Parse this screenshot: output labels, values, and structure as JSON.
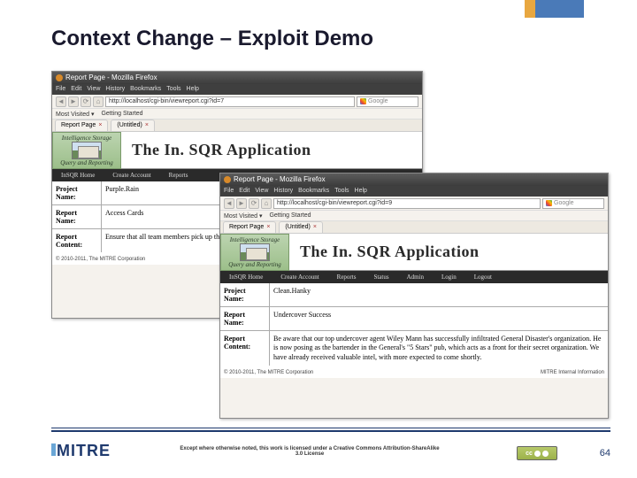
{
  "slide": {
    "title": "Context Change – Exploit Demo",
    "page_number": "64",
    "license_text": "Except where otherwise noted, this work is licensed under a Creative Commons Attribution-ShareAlike 3.0 License",
    "logo": "MITRE",
    "cc_label": "cc"
  },
  "browser_a": {
    "title": "Report Page - Mozilla Firefox",
    "menu": [
      "File",
      "Edit",
      "View",
      "History",
      "Bookmarks",
      "Tools",
      "Help"
    ],
    "url": "http://localhost/cgi-bin/viewreport.cgi?id=7",
    "search_placeholder": "Google",
    "bookmarks": [
      "Most Visited ▾",
      "Getting Started"
    ],
    "tabs": [
      {
        "label": "Report Page"
      },
      {
        "label": "(Untitled)"
      }
    ],
    "banner": {
      "top": "Intelligence Storage",
      "bottom": "Query and Reporting",
      "app_title": "The In. SQR Application"
    },
    "nav_items": [
      "InSQR Home",
      "Create Account",
      "Reports"
    ],
    "form": [
      {
        "label": "Project Name:",
        "value": "Purple.Rain"
      },
      {
        "label": "Report Name:",
        "value": "Access Cards"
      },
      {
        "label": "Report Content:",
        "value": "Ensure that all team members pick up their new Access Cards and destroy your old cards once…"
      }
    ],
    "copyright": "© 2010-2011, The MITRE Corporation"
  },
  "browser_b": {
    "title": "Report Page - Mozilla Firefox",
    "menu": [
      "File",
      "Edit",
      "View",
      "History",
      "Bookmarks",
      "Tools",
      "Help"
    ],
    "url": "http://localhost/cgi-bin/viewreport.cgi?id=9",
    "search_placeholder": "Google",
    "bookmarks": [
      "Most Visited ▾",
      "Getting Started"
    ],
    "tabs": [
      {
        "label": "Report Page"
      },
      {
        "label": "(Untitled)"
      }
    ],
    "banner": {
      "top": "Intelligence Storage",
      "bottom": "Query and Reporting",
      "app_title": "The In. SQR Application"
    },
    "nav_items": [
      "InSQR Home",
      "Create Account",
      "Reports",
      "Status",
      "Admin",
      "Login",
      "Logout"
    ],
    "form": [
      {
        "label": "Project Name:",
        "value": "Clean.Hanky"
      },
      {
        "label": "Report Name:",
        "value": "Undercover Success"
      },
      {
        "label": "Report Content:",
        "value": "Be aware that our top undercover agent Wiley Mann has successfully infiltrated General Disaster's organization. He is now posing as the bartender in the General's \"5 Stars\" pub, which acts as a front for their secret organization. We have already received valuable intel, with more expected to come shortly."
      }
    ],
    "copyright": "© 2010-2011, The MITRE Corporation",
    "copyright_right": "MITRE Internal Information"
  }
}
